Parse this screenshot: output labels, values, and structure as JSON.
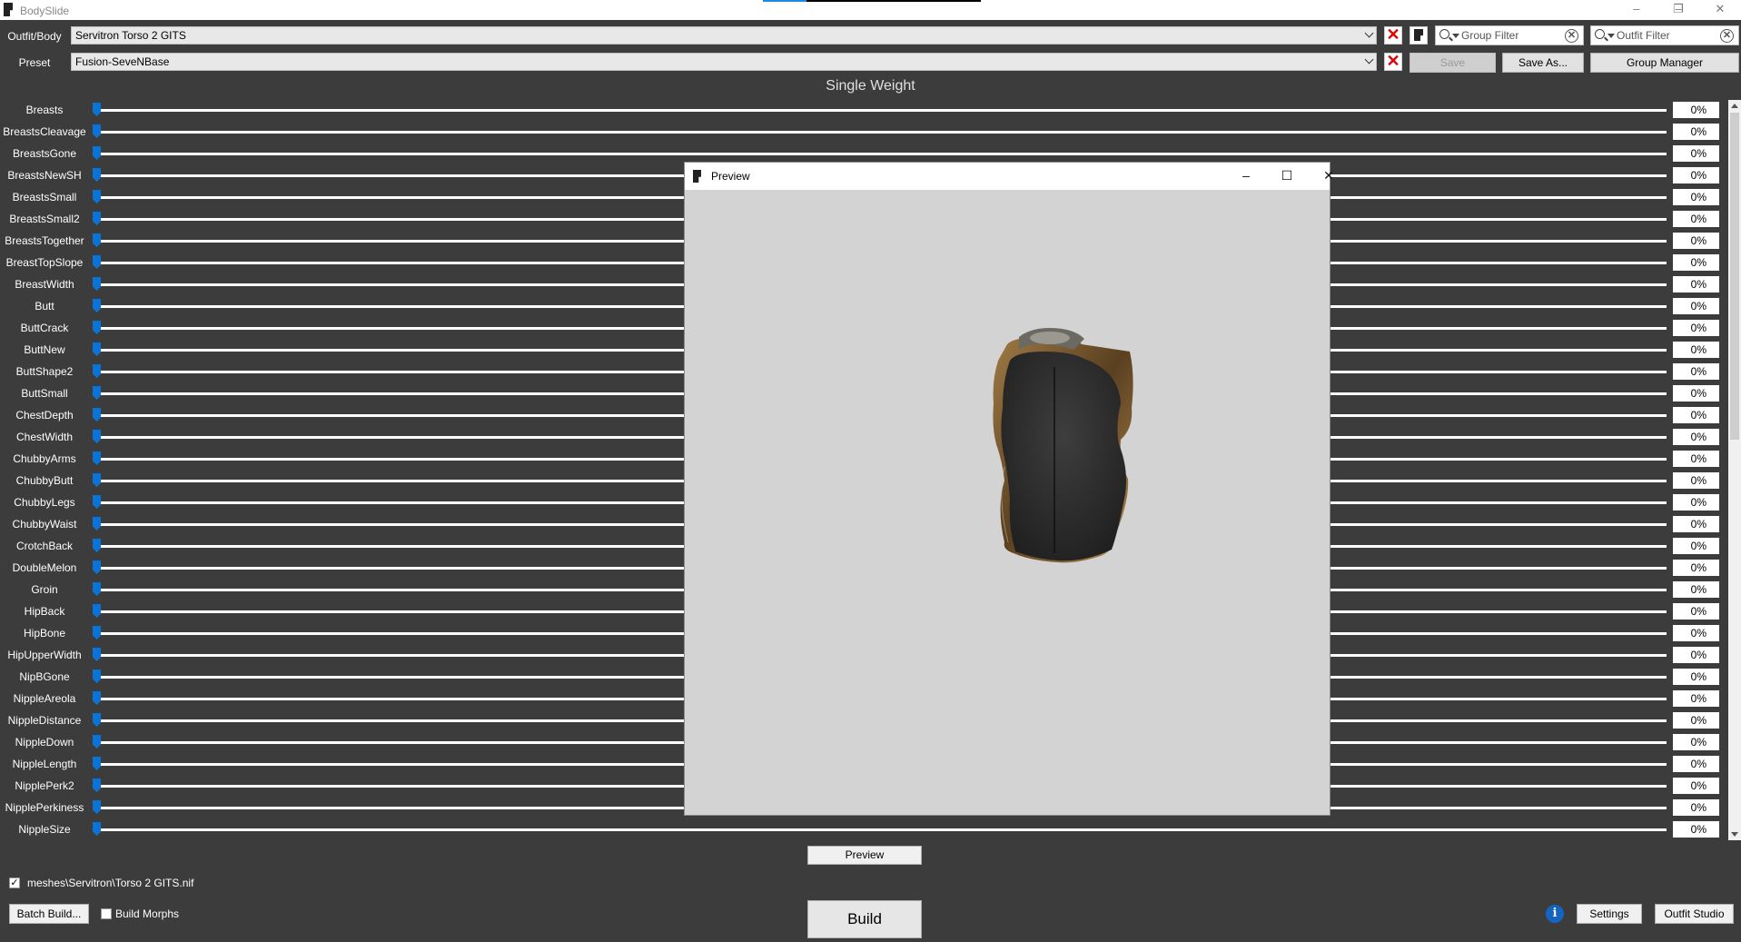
{
  "window": {
    "title": "BodySlide",
    "minimize": "–",
    "restore": "❐",
    "close": "✕"
  },
  "top": {
    "outfit_label": "Outfit/Body",
    "outfit_value": "Servitron Torso 2 GITS",
    "preset_label": "Preset",
    "preset_value": "Fusion-SeveNBase",
    "group_filter_placeholder": "Group Filter",
    "outfit_filter_placeholder": "Outfit Filter",
    "save_label": "Save",
    "save_as_label": "Save As...",
    "group_manager_label": "Group Manager",
    "clear_glyph": "✕"
  },
  "section_title": "Single Weight",
  "sliders": [
    {
      "name": "Breasts",
      "value": "0%"
    },
    {
      "name": "BreastsCleavage",
      "value": "0%"
    },
    {
      "name": "BreastsGone",
      "value": "0%"
    },
    {
      "name": "BreastsNewSH",
      "value": "0%"
    },
    {
      "name": "BreastsSmall",
      "value": "0%"
    },
    {
      "name": "BreastsSmall2",
      "value": "0%"
    },
    {
      "name": "BreastsTogether",
      "value": "0%"
    },
    {
      "name": "BreastTopSlope",
      "value": "0%"
    },
    {
      "name": "BreastWidth",
      "value": "0%"
    },
    {
      "name": "Butt",
      "value": "0%"
    },
    {
      "name": "ButtCrack",
      "value": "0%"
    },
    {
      "name": "ButtNew",
      "value": "0%"
    },
    {
      "name": "ButtShape2",
      "value": "0%"
    },
    {
      "name": "ButtSmall",
      "value": "0%"
    },
    {
      "name": "ChestDepth",
      "value": "0%"
    },
    {
      "name": "ChestWidth",
      "value": "0%"
    },
    {
      "name": "ChubbyArms",
      "value": "0%"
    },
    {
      "name": "ChubbyButt",
      "value": "0%"
    },
    {
      "name": "ChubbyLegs",
      "value": "0%"
    },
    {
      "name": "ChubbyWaist",
      "value": "0%"
    },
    {
      "name": "CrotchBack",
      "value": "0%"
    },
    {
      "name": "DoubleMelon",
      "value": "0%"
    },
    {
      "name": "Groin",
      "value": "0%"
    },
    {
      "name": "HipBack",
      "value": "0%"
    },
    {
      "name": "HipBone",
      "value": "0%"
    },
    {
      "name": "HipUpperWidth",
      "value": "0%"
    },
    {
      "name": "NipBGone",
      "value": "0%"
    },
    {
      "name": "NippleAreola",
      "value": "0%"
    },
    {
      "name": "NippleDistance",
      "value": "0%"
    },
    {
      "name": "NippleDown",
      "value": "0%"
    },
    {
      "name": "NippleLength",
      "value": "0%"
    },
    {
      "name": "NipplePerk2",
      "value": "0%"
    },
    {
      "name": "NipplePerkiness",
      "value": "0%"
    },
    {
      "name": "NippleSize",
      "value": "0%"
    }
  ],
  "preview_window": {
    "title": "Preview",
    "minimize": "–",
    "maximize": "☐",
    "close": "✕"
  },
  "bottom": {
    "preview_label": "Preview",
    "output_path": "meshes\\Servitron\\Torso 2 GITS.nif",
    "output_checked": true,
    "check_glyph": "✓",
    "batch_build_label": "Batch Build...",
    "build_morphs_label": "Build Morphs",
    "build_morphs_checked": false,
    "build_label": "Build",
    "info_glyph": "i",
    "settings_label": "Settings",
    "outfit_studio_label": "Outfit Studio"
  },
  "colors": {
    "background": "#3c3c3c",
    "slider_handle": "#0a74d6",
    "clear_x": "#e00000",
    "preview_bg": "#d3d3d3"
  }
}
